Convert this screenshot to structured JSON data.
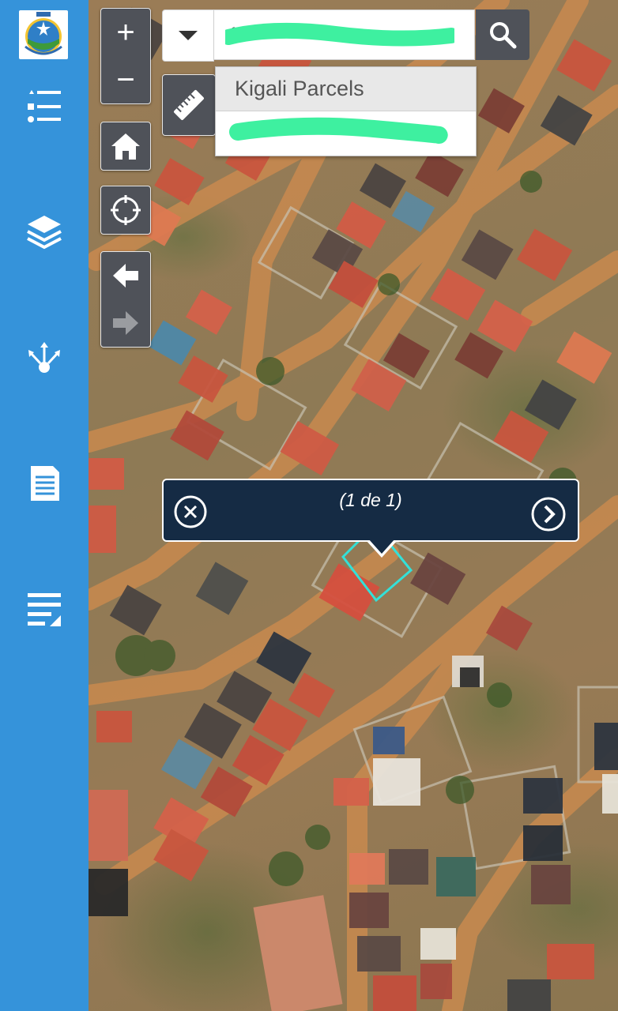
{
  "sidebar": {
    "logo": "seal-logo",
    "items": [
      {
        "name": "list-icon"
      },
      {
        "name": "layers-icon"
      },
      {
        "name": "share-network-icon"
      },
      {
        "name": "document-icon"
      },
      {
        "name": "edit-lines-icon"
      }
    ]
  },
  "search": {
    "value_visible": "1",
    "clear_icon": "close-icon",
    "go_icon": "search-icon",
    "dropdown_icon": "caret-down-icon",
    "suggestions": [
      "Kigali Parcels",
      ""
    ]
  },
  "tools": {
    "zoom_in": "+",
    "zoom_out": "−",
    "measure_icon": "ruler-icon",
    "home_icon": "home-icon",
    "locate_icon": "locate-icon",
    "back_icon": "arrow-left-icon",
    "forward_icon": "arrow-right-icon"
  },
  "popup": {
    "count": "(1 de 1)",
    "close_icon": "close-circle-icon",
    "next_icon": "chevron-right-circle-icon"
  },
  "colors": {
    "sidebar": "#3593da",
    "tool_bg": "#4f5259",
    "popup_bg": "#152b44",
    "highlight": "#33e0d8",
    "redaction": "#3ef0a0"
  }
}
